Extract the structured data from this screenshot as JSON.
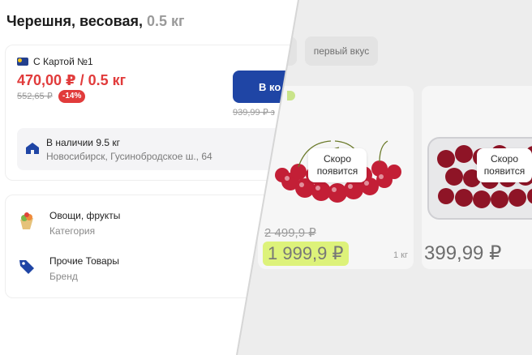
{
  "catalog": {
    "chip_flavor": "первый вкус",
    "card1": {
      "overlay": "Скоро появится",
      "old_price": "2 499,9 ₽",
      "price": "1 999,9 ₽",
      "unit": "1 кг"
    },
    "card2": {
      "overlay": "Скоро появится",
      "price": "399,99 ₽"
    }
  },
  "product": {
    "title": "Черешня, весовая,",
    "weight": "0.5 кг",
    "card_label": "С Картой №1",
    "price": "470,00 ₽",
    "price_unit": "/ 0.5 кг",
    "old_price": "552,65 ₽",
    "discount": "-14%",
    "cart_button": "В ко",
    "cart_old_price": "939,99 ₽ з",
    "stock_title": "В наличии 9.5 кг",
    "stock_address": "Новосибирск, Гусинобродское ш., 64"
  },
  "info": {
    "category_value": "Овощи, фрукты",
    "category_label": "Категория",
    "brand_value": "Прочие Товары",
    "brand_label": "Бренд"
  },
  "colors": {
    "price_red": "#e13b3b",
    "brand_blue": "#1f45a5",
    "promo_highlight": "#ddf27a"
  }
}
